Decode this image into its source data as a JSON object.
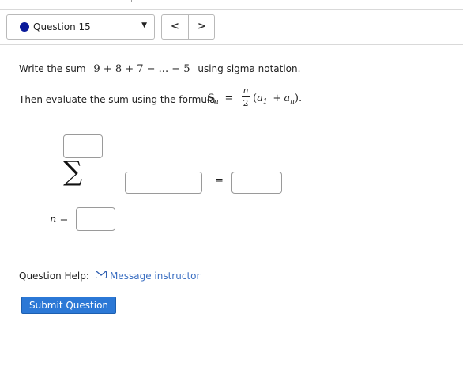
{
  "header": {
    "question_select_value": "Question 15",
    "prev_symbol": "<",
    "next_symbol": ">"
  },
  "problem": {
    "line1_prefix": "Write the sum",
    "sum_expression": "9 + 8 + 7 − ... − 5",
    "line1_suffix": "using sigma notation.",
    "line2_prefix": "Then evaluate the sum using the formula",
    "formula_lhs": "S",
    "formula_lhs_sub": "n",
    "formula_eq": "=",
    "frac_num": "n",
    "frac_den": "2",
    "formula_open": "(",
    "a1": "a",
    "a1_sub": "1",
    "plus": "+",
    "an": "a",
    "an_sub": "n",
    "formula_close": ")."
  },
  "answer": {
    "sigma_symbol": "∑",
    "index_label": "n =",
    "equals": "=",
    "upper_limit_value": "",
    "summand_value": "",
    "lower_limit_value": "",
    "result_value": ""
  },
  "help": {
    "label": "Question Help:",
    "message_link": "Message instructor",
    "icon": "mail-icon"
  },
  "submit_label": "Submit Question",
  "colors": {
    "accent": "#2b78d6",
    "link": "#3b6fc2",
    "status_dot": "#0a1a9a"
  }
}
